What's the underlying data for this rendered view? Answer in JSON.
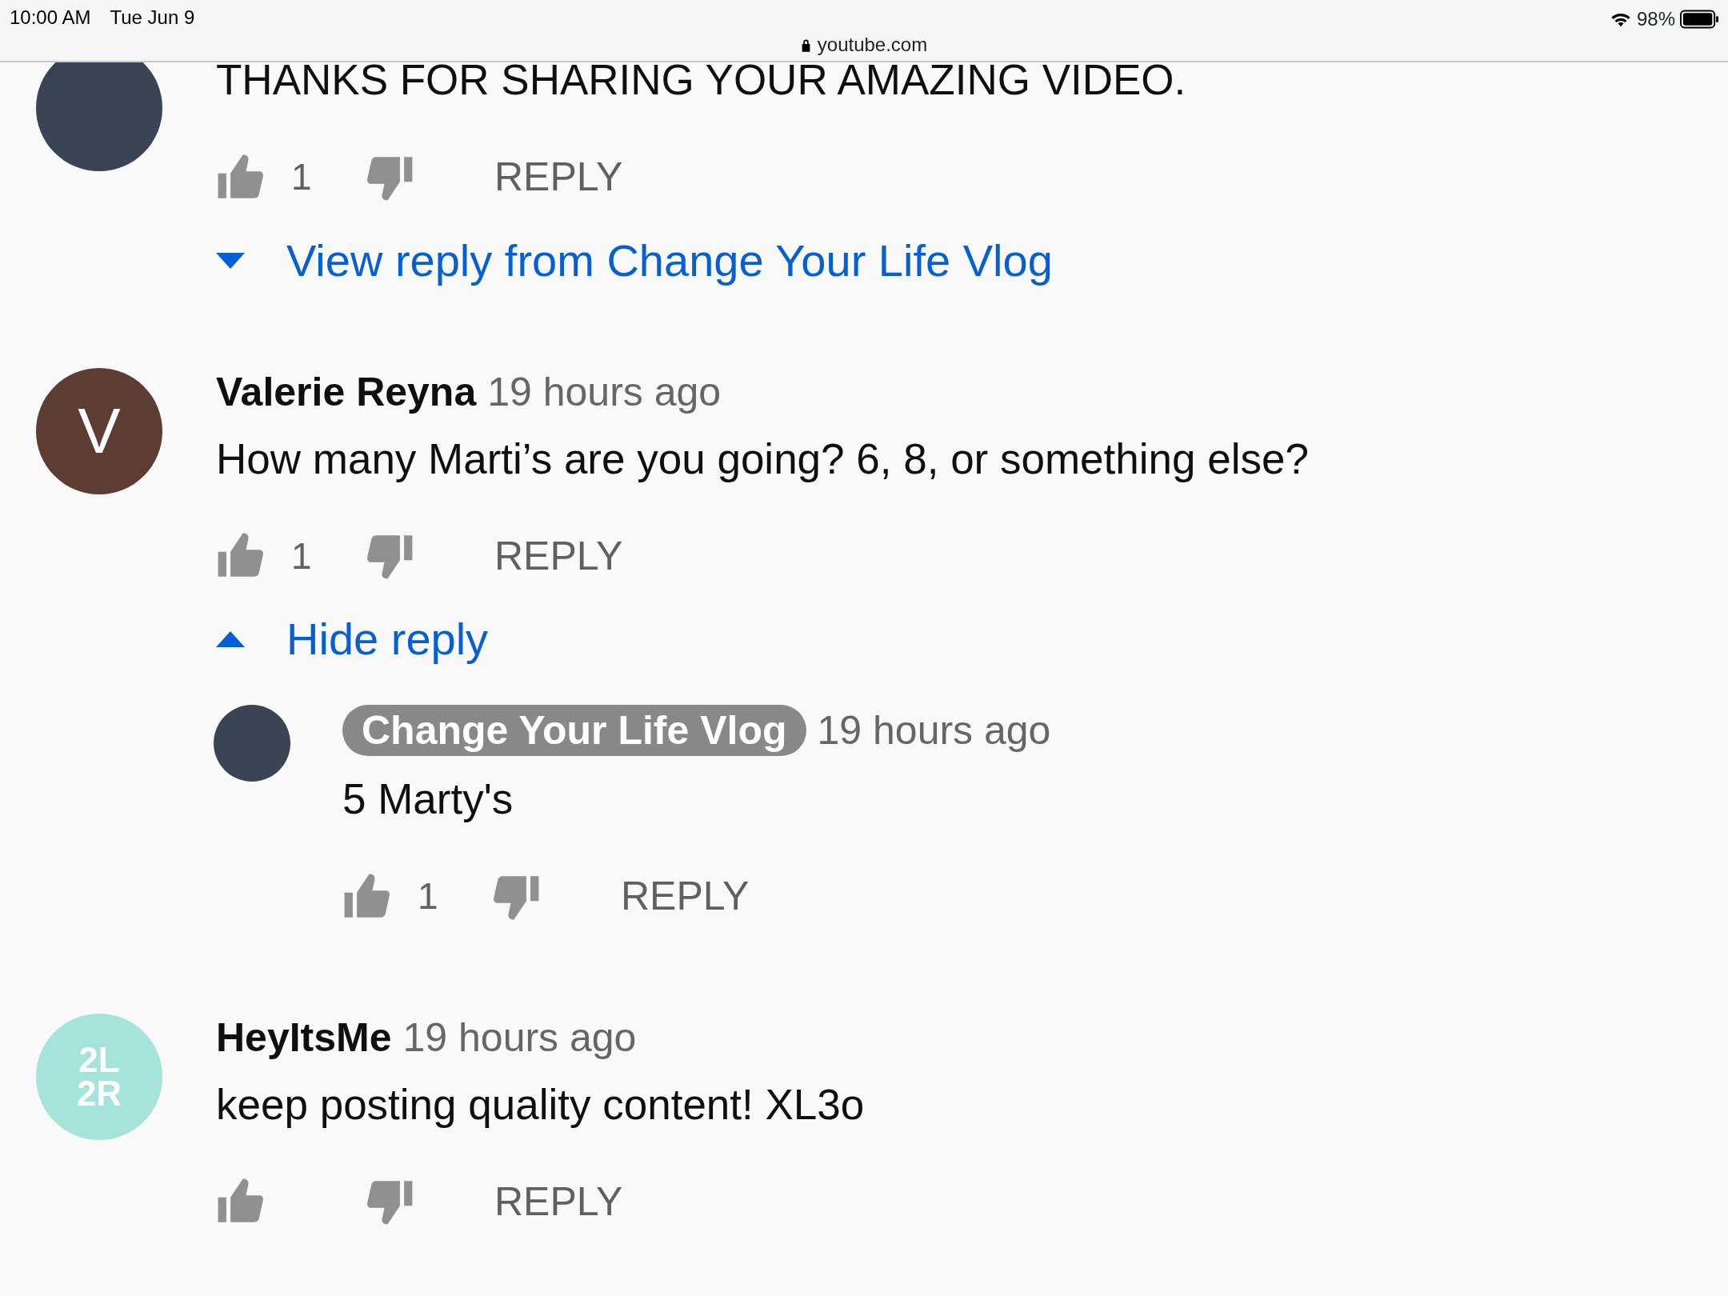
{
  "status_bar": {
    "time": "10:00 AM",
    "date": "Tue Jun 9",
    "battery": "98%"
  },
  "address_bar": {
    "url": "youtube.com"
  },
  "comments": [
    {
      "avatar": {
        "kind": "photo"
      },
      "text": "THANKS FOR SHARING YOUR AMAZING VIDEO.",
      "likes": "1",
      "reply_label": "REPLY",
      "replies_toggle": {
        "label": "View reply from Change Your Life Vlog",
        "expanded": false
      }
    },
    {
      "avatar": {
        "kind": "letter",
        "letter": "V",
        "color": "#5d3c33"
      },
      "author": "Valerie Reyna",
      "is_creator": false,
      "time": "19 hours ago",
      "text": "How many Marti’s are you going? 6, 8, or something else?",
      "likes": "1",
      "reply_label": "REPLY",
      "replies_toggle": {
        "label": "Hide reply",
        "expanded": true
      },
      "replies": [
        {
          "avatar": {
            "kind": "photo"
          },
          "author": "Change Your Life Vlog",
          "is_creator": true,
          "time": "19 hours ago",
          "text": "5 Marty's",
          "likes": "1",
          "reply_label": "REPLY"
        }
      ]
    },
    {
      "avatar": {
        "kind": "logo",
        "lines": [
          "2L",
          "2R"
        ],
        "color": "#a6e3da"
      },
      "author": "HeyItsMe",
      "is_creator": false,
      "time": "19 hours ago",
      "text": "keep posting quality content! XL3o",
      "reply_label": "REPLY"
    }
  ]
}
